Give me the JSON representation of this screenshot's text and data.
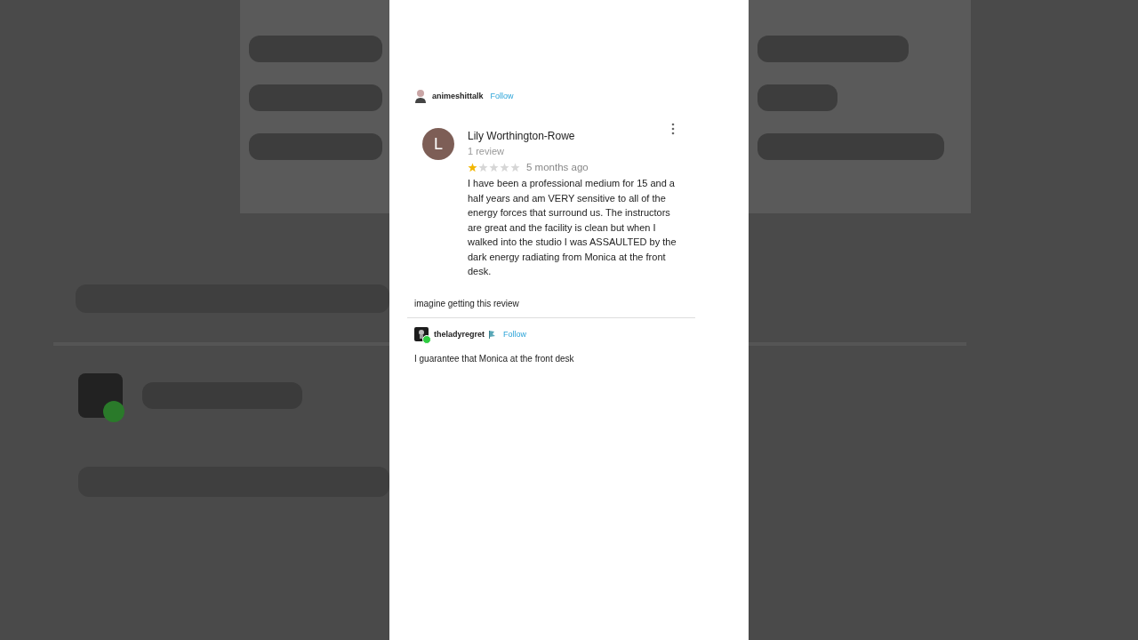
{
  "post": {
    "author": "animeshittalk",
    "follow": "Follow",
    "review": {
      "initial": "L",
      "name": "Lily Worthington-Rowe",
      "count": "1 review",
      "stars": 1,
      "time": "5 months ago",
      "text": "I have been a professional medium for 15 and a half years and am VERY sensitive to all of the energy forces that surround us. The instructors are great and the facility is clean but when I walked into the studio I was ASSAULTED by the dark energy radiating from Monica at the front desk."
    },
    "caption": "imagine getting this review"
  },
  "reply": {
    "author": "theladyregret",
    "follow": "Follow",
    "online": true,
    "text": "I guarantee that Monica at the front desk"
  }
}
